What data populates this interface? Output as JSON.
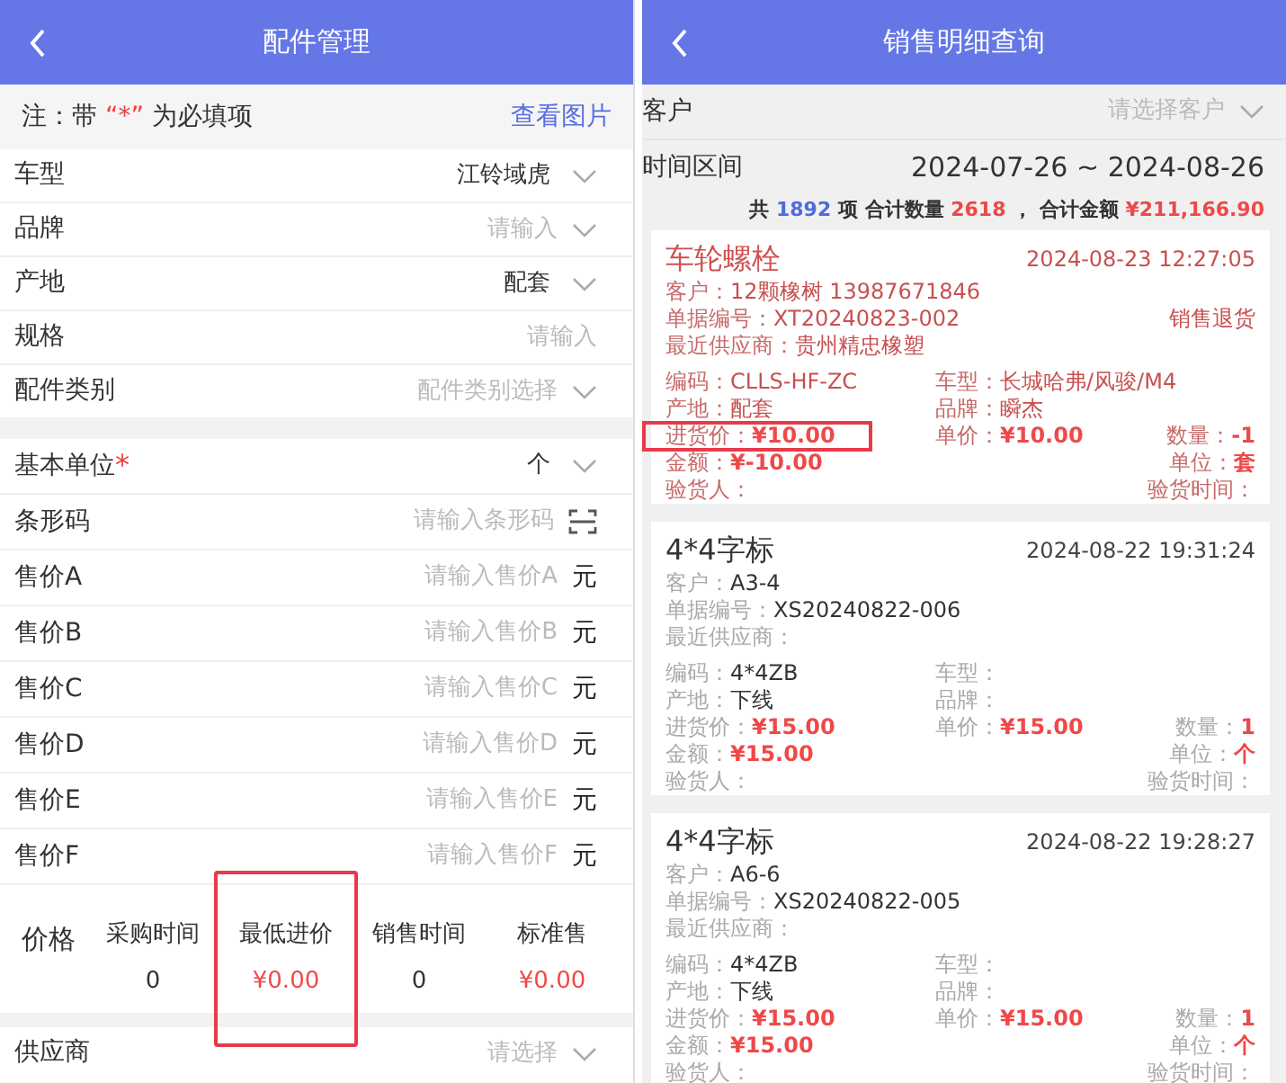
{
  "parts_screen": {
    "title": "配件管理",
    "required_symbol": "*",
    "note": {
      "prefix": "注：带 ",
      "mark": "“*”",
      "suffix": " 为必填项",
      "link": "查看图片"
    },
    "groups": [
      {
        "rows": [
          {
            "kind": "select",
            "label": "车型",
            "value": "江铃域虎",
            "required": false
          },
          {
            "kind": "select",
            "label": "品牌",
            "placeholder": "请输入",
            "required": false
          },
          {
            "kind": "select",
            "label": "产地",
            "value": "配套",
            "required": false
          },
          {
            "kind": "input",
            "label": "规格",
            "placeholder": "请输入",
            "required": false
          },
          {
            "kind": "select",
            "label": "配件类别",
            "placeholder": "配件类别选择",
            "required": false
          }
        ]
      },
      {
        "rows": [
          {
            "kind": "select",
            "label": "基本单位",
            "value": "个",
            "required": true
          },
          {
            "kind": "scan",
            "label": "条形码",
            "placeholder": "请输入条形码",
            "required": false
          },
          {
            "kind": "price",
            "label": "售价A",
            "placeholder": "请输入售价A",
            "suffix": "元",
            "required": false
          },
          {
            "kind": "price",
            "label": "售价B",
            "placeholder": "请输入售价B",
            "suffix": "元",
            "required": false
          },
          {
            "kind": "price",
            "label": "售价C",
            "placeholder": "请输入售价C",
            "suffix": "元",
            "required": false
          },
          {
            "kind": "price",
            "label": "售价D",
            "placeholder": "请输入售价D",
            "suffix": "元",
            "required": false
          },
          {
            "kind": "price",
            "label": "售价E",
            "placeholder": "请输入售价E",
            "suffix": "元",
            "required": false
          },
          {
            "kind": "price",
            "label": "售价F",
            "placeholder": "请输入售价F",
            "suffix": "元",
            "required": false
          }
        ]
      }
    ],
    "price": {
      "label": "价格",
      "columns": [
        {
          "label": "采购时间",
          "value": "0",
          "kind": "count",
          "highlighted": false
        },
        {
          "label": "最低进价",
          "value": "¥0.00",
          "kind": "money",
          "highlighted": true
        },
        {
          "label": "销售时间",
          "value": "0",
          "kind": "count",
          "highlighted": false
        },
        {
          "label": "标准售",
          "value": "¥0.00",
          "kind": "money",
          "highlighted": false
        }
      ]
    },
    "footer_rows": [
      {
        "kind": "select",
        "label": "供应商",
        "placeholder": "请选择",
        "required": false
      }
    ]
  },
  "sales_screen": {
    "title": "销售明细查询",
    "customer": {
      "label": "客户",
      "placeholder": "请选择客户"
    },
    "period": {
      "label": "时间区间",
      "from": "2024-07-26",
      "separator": "~",
      "to": "2024-08-26"
    },
    "summary": [
      {
        "text": "共",
        "color": "#333333"
      },
      {
        "text": "1892",
        "color": "#4f6ae0"
      },
      {
        "text": "项 合计数量",
        "color": "#333333"
      },
      {
        "text": "2618",
        "color": "#f04848"
      },
      {
        "text": "， 合计金额",
        "color": "#333333"
      },
      {
        "text": "¥211,166.90",
        "color": "#f04848"
      }
    ],
    "cards": [
      {
        "returned": true,
        "title": "车轮螺栓",
        "time": "2024-08-23 12:27:05",
        "tag": "销售退货",
        "lines": [
          {
            "label": "客户：",
            "value": "12颗橡树 13987671846"
          },
          {
            "label": "单据编号：",
            "value": "XT20240823-002"
          },
          {
            "label": "最近供应商：",
            "value": "贵州精忠橡塑"
          }
        ],
        "grid": [
          {
            "left": {
              "label": "编码：",
              "value": "CLLS-HF-ZC",
              "emphasis": false,
              "highlighted": false
            },
            "middle": {
              "label": "车型：",
              "value": "长城哈弗/风骏/M4",
              "emphasis": false,
              "highlighted": false
            }
          },
          {
            "left": {
              "label": "产地：",
              "value": "配套",
              "emphasis": false,
              "highlighted": false
            },
            "middle": {
              "label": "品牌：",
              "value": "瞬杰",
              "emphasis": false,
              "highlighted": false
            }
          },
          {
            "left": {
              "label": "进货价：",
              "value": "¥10.00",
              "emphasis": true,
              "highlighted": true
            },
            "middle": {
              "label": "单价：",
              "value": "¥10.00",
              "emphasis": true,
              "highlighted": false
            },
            "right": {
              "label": "数量：",
              "value": "-1",
              "emphasis": true,
              "highlighted": false
            }
          },
          {
            "left": {
              "label": "金额：",
              "value": "¥-10.00",
              "emphasis": true,
              "highlighted": false
            },
            "right": {
              "label": "单位：",
              "value": "套",
              "emphasis": true,
              "highlighted": false
            }
          },
          {
            "left": {
              "label": "验货人：",
              "highlighted": false
            },
            "right": {
              "label": "验货时间：",
              "highlighted": false
            }
          }
        ]
      },
      {
        "returned": false,
        "title": "4*4字标",
        "time": "2024-08-22 19:31:24",
        "lines": [
          {
            "label": "客户：",
            "value": "A3-4"
          },
          {
            "label": "单据编号：",
            "value": "XS20240822-006"
          },
          {
            "label": "最近供应商："
          }
        ],
        "grid": [
          {
            "left": {
              "label": "编码：",
              "value": "4*4ZB",
              "emphasis": false,
              "highlighted": false
            },
            "middle": {
              "label": "车型：",
              "highlighted": false
            }
          },
          {
            "left": {
              "label": "产地：",
              "value": "下线",
              "emphasis": false,
              "highlighted": false
            },
            "middle": {
              "label": "品牌：",
              "highlighted": false
            }
          },
          {
            "left": {
              "label": "进货价：",
              "value": "¥15.00",
              "emphasis": true,
              "highlighted": false
            },
            "middle": {
              "label": "单价：",
              "value": "¥15.00",
              "emphasis": true,
              "highlighted": false
            },
            "right": {
              "label": "数量：",
              "value": "1",
              "emphasis": true,
              "highlighted": false
            }
          },
          {
            "left": {
              "label": "金额：",
              "value": "¥15.00",
              "emphasis": true,
              "highlighted": false
            },
            "right": {
              "label": "单位：",
              "value": "个",
              "emphasis": true,
              "highlighted": false
            }
          },
          {
            "left": {
              "label": "验货人：",
              "highlighted": false
            },
            "right": {
              "label": "验货时间：",
              "highlighted": false
            }
          }
        ]
      },
      {
        "returned": false,
        "title": "4*4字标",
        "time": "2024-08-22 19:28:27",
        "lines": [
          {
            "label": "客户：",
            "value": "A6-6"
          },
          {
            "label": "单据编号：",
            "value": "XS20240822-005"
          },
          {
            "label": "最近供应商："
          }
        ],
        "grid": [
          {
            "left": {
              "label": "编码：",
              "value": "4*4ZB",
              "emphasis": false,
              "highlighted": false
            },
            "middle": {
              "label": "车型：",
              "highlighted": false
            }
          },
          {
            "left": {
              "label": "产地：",
              "value": "下线",
              "emphasis": false,
              "highlighted": false
            },
            "middle": {
              "label": "品牌：",
              "highlighted": false
            }
          },
          {
            "left": {
              "label": "进货价：",
              "value": "¥15.00",
              "emphasis": true,
              "highlighted": false
            },
            "middle": {
              "label": "单价：",
              "value": "¥15.00",
              "emphasis": true,
              "highlighted": false
            },
            "right": {
              "label": "数量：",
              "value": "1",
              "emphasis": true,
              "highlighted": false
            }
          },
          {
            "left": {
              "label": "金额：",
              "value": "¥15.00",
              "emphasis": true,
              "highlighted": false
            },
            "right": {
              "label": "单位：",
              "value": "个",
              "emphasis": true,
              "highlighted": false
            }
          },
          {
            "left": {
              "label": "验货人：",
              "highlighted": false
            },
            "right": {
              "label": "验货时间：",
              "highlighted": false
            }
          }
        ]
      }
    ]
  }
}
